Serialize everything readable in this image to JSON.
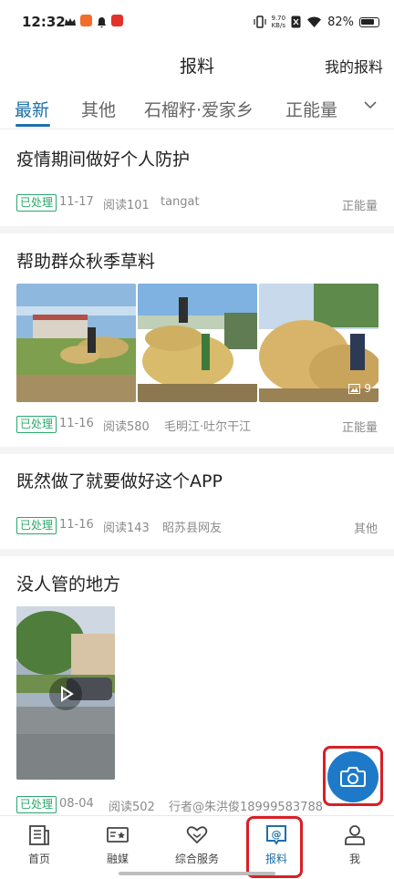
{
  "status_bar": {
    "time": "12:32",
    "net_speed_value": "9.70",
    "net_speed_unit": "KB/s",
    "battery": "82%"
  },
  "header": {
    "title": "报料",
    "my_report": "我的报料"
  },
  "tabs": [
    {
      "label": "最新",
      "active": true
    },
    {
      "label": "其他",
      "active": false
    },
    {
      "label": "石榴籽·爱家乡",
      "active": false
    },
    {
      "label": "正能量",
      "active": false
    }
  ],
  "posts": [
    {
      "title": "疫情期间做好个人防护",
      "status": "已处理",
      "date": "11-17",
      "reads": "阅读101",
      "author": "tangat",
      "category": "正能量"
    },
    {
      "title": "帮助群众秋季草料",
      "status": "已处理",
      "date": "11-16",
      "reads": "阅读580",
      "author": "毛明江·吐尔干江",
      "category": "正能量",
      "photo_count": "9"
    },
    {
      "title": "既然做了就要做好这个APP",
      "status": "已处理",
      "date": "11-16",
      "reads": "阅读143",
      "author": "昭苏县网友",
      "category": "其他"
    },
    {
      "title": "没人管的地方",
      "status": "已处理",
      "date": "08-04",
      "reads": "阅读502",
      "author": "行者@朱洪俊18999583788",
      "category": ""
    }
  ],
  "bottom_nav": [
    {
      "label": "首页",
      "icon": "newspaper-icon",
      "active": false
    },
    {
      "label": "融媒",
      "icon": "tv-star-icon",
      "active": false
    },
    {
      "label": "综合服务",
      "icon": "heart-hands-icon",
      "active": false
    },
    {
      "label": "报料",
      "icon": "at-chat-icon",
      "active": true
    },
    {
      "label": "我",
      "icon": "person-icon",
      "active": false
    }
  ],
  "colors": {
    "accent": "#1e6fa8",
    "badge_green": "#2aa86b",
    "highlight_red": "#d81f26",
    "fab_blue": "#1e7ac9"
  }
}
